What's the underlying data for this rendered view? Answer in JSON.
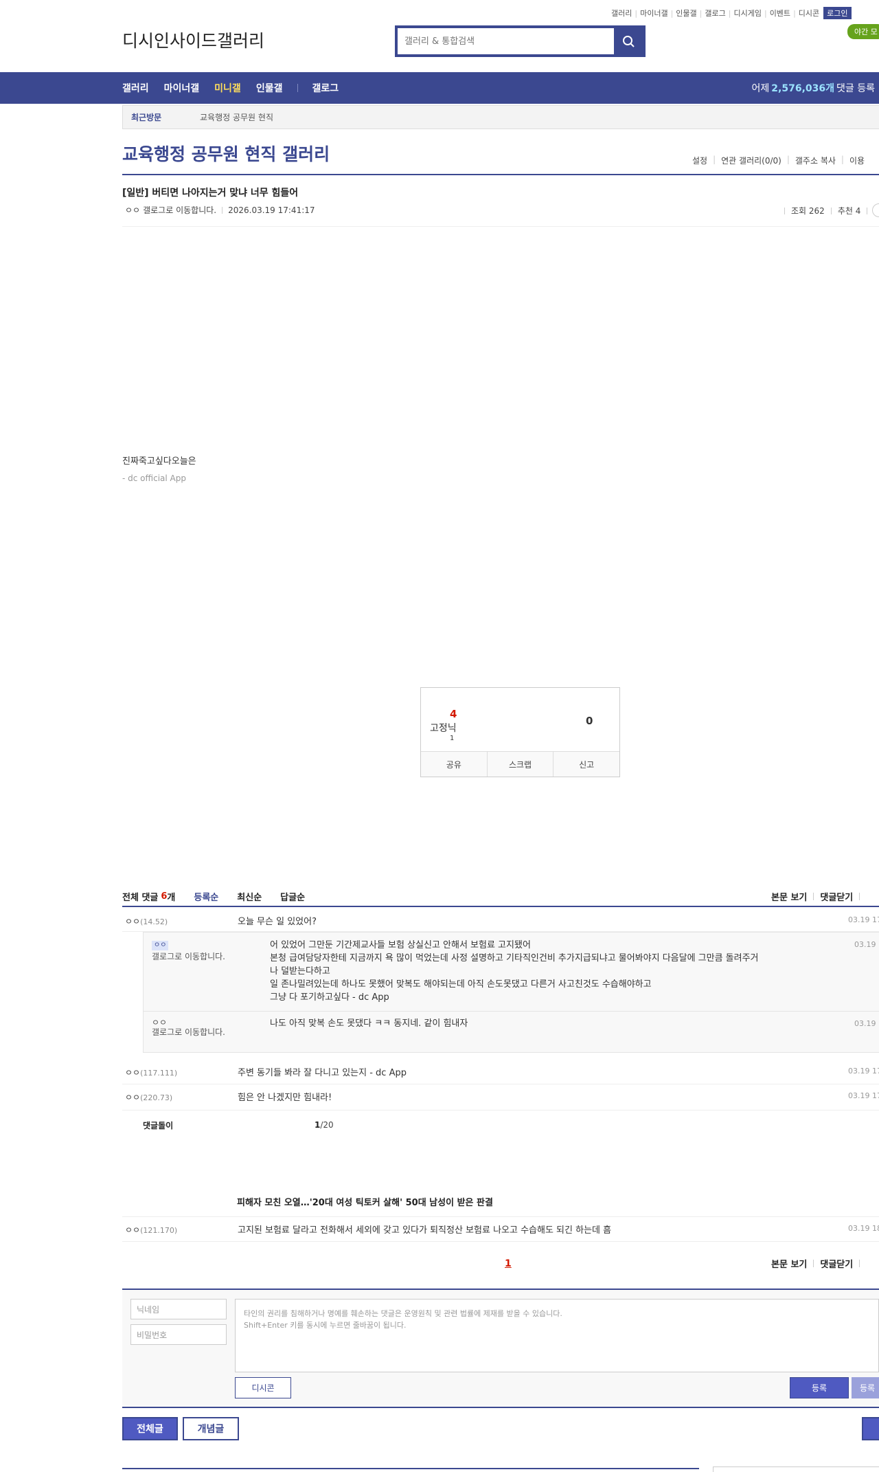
{
  "util_links": [
    "갤러리",
    "마이너갤",
    "인물갤",
    "갤로그",
    "디시게임",
    "이벤트",
    "디시콘"
  ],
  "login_label": "로그인",
  "night_mode_label": "야간 모",
  "logo_text": "디시인사이드갤러리",
  "search": {
    "placeholder": "갤러리 & 통합검색"
  },
  "nav": {
    "items": [
      "갤러리",
      "마이너갤",
      "미니갤",
      "인물갤",
      "갤로그"
    ],
    "stat_prefix": "어제",
    "stat_count": "2,576,036개",
    "stat_suffix": "댓글 등록"
  },
  "recent": {
    "label": "최근방문",
    "value": "교육행정 공무원 현직"
  },
  "gallery": {
    "title": "교육행정 공무원 현직 갤러리",
    "menu": [
      "설정",
      "연관 갤러리(0/0)",
      "갤주소 복사",
      "이용"
    ]
  },
  "post": {
    "title": "[일반] 버티면 나아지는거 맞냐 너무 힘들어",
    "author": "ㅇㅇ",
    "author_img_alt": "갤로그로 이동합니다.",
    "date": "2026.03.19 17:41:17",
    "views": "조회 262",
    "recommend": "추천 4",
    "body": "진짜죽고싶다오늘은",
    "app_sig": "- dc official App"
  },
  "rec_box": {
    "up_count": "4",
    "fix_label": "고정닉",
    "fix_count": "1",
    "down_count": "0",
    "buttons": [
      "공유",
      "스크랩",
      "신고"
    ]
  },
  "comments": {
    "head_prefix": "전체 댓글",
    "count": "6",
    "count_suffix": "개",
    "sorts": [
      "등록순",
      "최신순",
      "답글순"
    ],
    "right_links": [
      "본문 보기",
      "댓글닫기"
    ],
    "items": [
      {
        "nick": "ㅇㅇ",
        "ip": "(14.52)",
        "text": "오늘 무슨 일 있었어?",
        "date": "03.19 17"
      },
      {
        "nick": "ㅇㅇ",
        "ip": "(117.111)",
        "text": "주변 동기들 봐라 잘 다니고 있는지 - dc App",
        "date": "03.19 17"
      },
      {
        "nick": "ㅇㅇ",
        "ip": "(220.73)",
        "text": "힘은 안 나겠지만 힘내라!",
        "date": "03.19 17"
      }
    ],
    "replies": [
      {
        "badge": "ㅇㅇ",
        "nick": "갤로그로 이동합니다.",
        "lines": [
          "어 있었어 그만둔 기간제교사들 보험 상실신고 안해서 보험료 고지됐어",
          "본청 급여담당자한테 지금까지 욕 많이 먹었는데 사정 설명하고 기타직인건비 추가지급되냐고 물어봐야지 다음달에 그만큼 돌려주거",
          "나 덜받는다하고",
          "일 존나밀려있는데 하나도 못했어 맞복도 해야되는데 아직 손도못댔고 다른거 사고친것도 수습해야하고",
          "그냥 다 포기하고싶다 - dc App"
        ],
        "date": "03.19 1"
      },
      {
        "badge": "ㅇㅇ",
        "nick": "갤로그로 이동합니다.",
        "lines": [
          "나도 아직 맞복 손도 못댔다 ㅋㅋ 동지네. 같이 힘내자"
        ],
        "date": "03.19 1"
      }
    ],
    "bot_label": "댓글돌이",
    "bot_page_current": "1",
    "bot_page_total": "/20",
    "news": "피해자 모친 오열…'20대 여성 틱토커 살해' 50대 남성이 받은 판결",
    "last": {
      "nick": "ㅇㅇ",
      "ip": "(121.170)",
      "text": "고지된 보험료 달라고 전화해서 세외에 갖고 있다가 퇴직정산 보험료 나오고 수습해도 되긴 하는데 흠",
      "date": "03.19 18"
    },
    "page": "1"
  },
  "write": {
    "nick_placeholder": "닉네임",
    "pw_placeholder": "비밀번호",
    "notice1": "타인의 권리를 침해하거나 명예를 훼손하는 댓글은 운영원칙 및 관련 법률에 제재를 받을 수 있습니다.",
    "notice2": "Shift+Enter 키를 동시에 누르면 줄바꿈이 됩니다.",
    "dccon": "디시콘",
    "submit": "등록",
    "submit2": "등록"
  },
  "list_buttons": {
    "all": "전체글",
    "recommend": "개념글"
  },
  "colors": {
    "accent": "#3b4890",
    "highlight": "#d31900",
    "mini": "#ffde5b"
  }
}
